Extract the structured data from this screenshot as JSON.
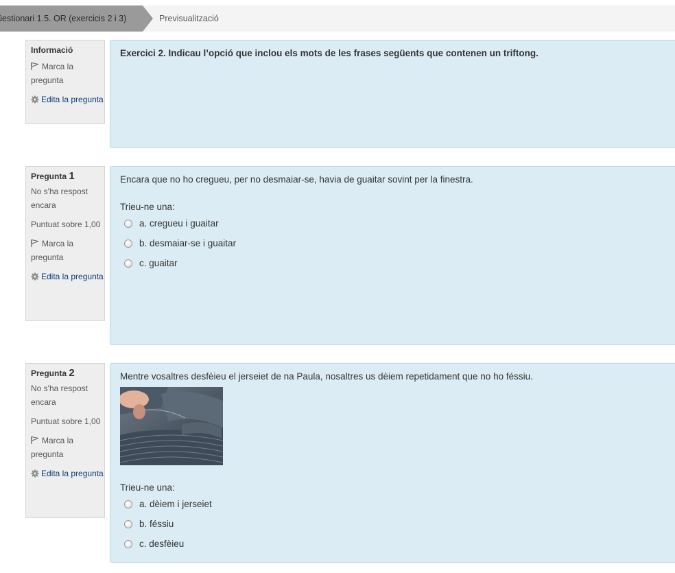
{
  "breadcrumb": {
    "item1": "üestionari 1.5. OR (exercicis 2 i 3)",
    "item2": "Previsualització"
  },
  "info_block": {
    "heading": "Informació",
    "flag_label": "Marca la pregunta",
    "edit_label": "Edita la pregunta",
    "text": "Exercici 2. Indicau l’opció que inclou els mots de les frases següents que contenen un triftong."
  },
  "questions": [
    {
      "label": "Pregunta",
      "number": "1",
      "state": "No s'ha respost encara",
      "grade": "Puntuat sobre 1,00",
      "flag_label": "Marca la pregunta",
      "edit_label": "Edita la pregunta",
      "text": "Encara que no ho cregueu, per no desmaiar-se, havia de guaitar sovint per la finestra.",
      "prompt": "Trieu-ne una:",
      "options": [
        "a. cregueu i guaitar",
        "b. desmaiar-se i guaitar",
        "c. guaitar"
      ]
    },
    {
      "label": "Pregunta",
      "number": "2",
      "state": "No s'ha respost encara",
      "grade": "Puntuat sobre 1,00",
      "flag_label": "Marca la pregunta",
      "edit_label": "Edita la pregunta",
      "text": "Mentre vosaltres desfèieu el jerseiet de na Paula, nosaltres us dèiem repetidament que no ho féssiu.",
      "prompt": "Trieu-ne una:",
      "options": [
        "a. dèiem i jerseiet",
        "b. féssiu",
        "c. desfèieu"
      ]
    }
  ],
  "colors": {
    "panel_bg": "#dbecf4",
    "panel_border": "#b5d9e6",
    "info_bg": "#eeeeee",
    "link": "#0b3b7e",
    "breadcrumb_active": "#9a9a9a"
  },
  "icons": [
    "flag-icon",
    "gear-icon",
    "radio-button"
  ]
}
